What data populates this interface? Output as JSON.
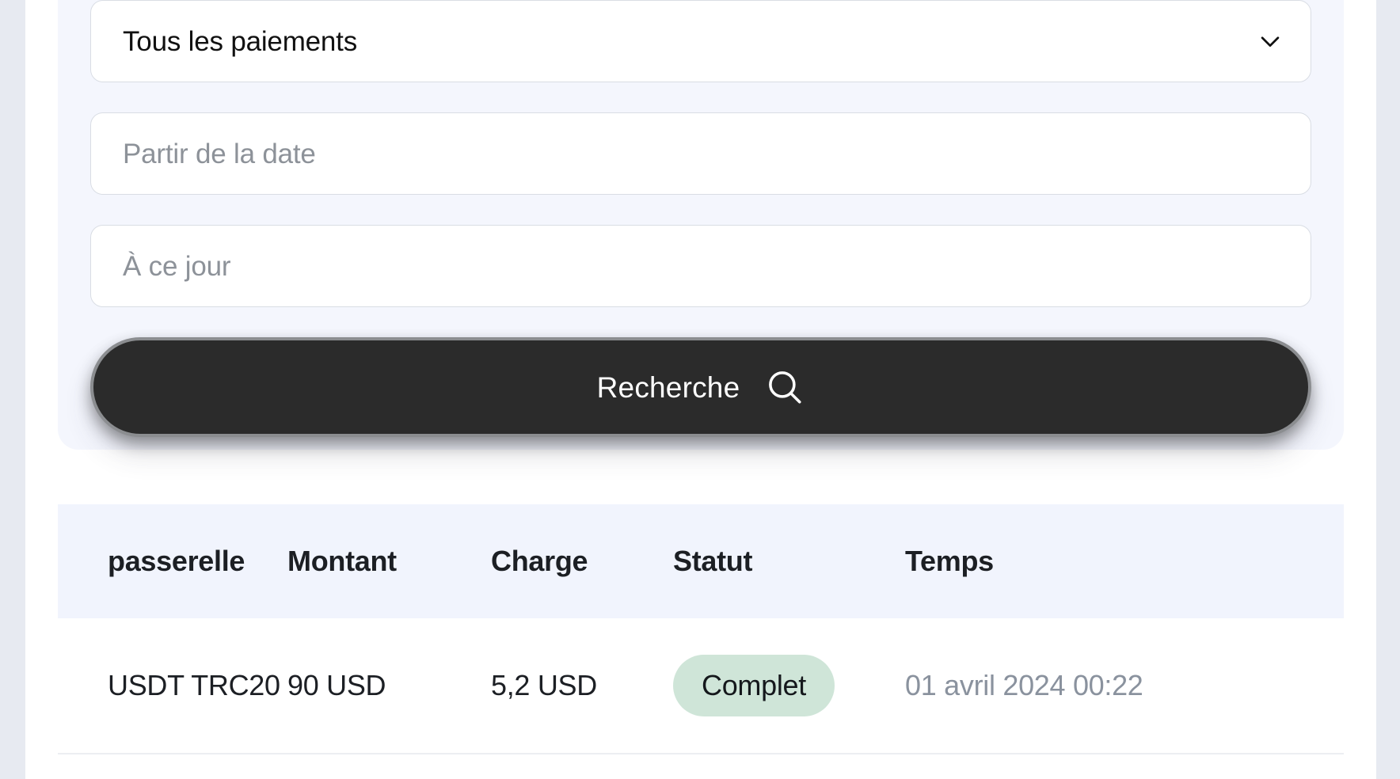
{
  "filters": {
    "payment_type_select": {
      "value": "Tous les paiements",
      "icon": "chevron-down-icon"
    },
    "date_from": {
      "value": "",
      "placeholder": "Partir de la date"
    },
    "date_to": {
      "value": "",
      "placeholder": "À ce jour"
    },
    "search_button": {
      "label": "Recherche",
      "icon": "search-icon"
    }
  },
  "table": {
    "columns": [
      {
        "key": "gateway",
        "label": "passerelle"
      },
      {
        "key": "amount",
        "label": "Montant"
      },
      {
        "key": "charge",
        "label": "Charge"
      },
      {
        "key": "status",
        "label": "Statut"
      },
      {
        "key": "time",
        "label": "Temps"
      }
    ],
    "rows": [
      {
        "gateway": "USDT TRC20",
        "amount": "90 USD",
        "charge": "5,2 USD",
        "status": "Complet",
        "time": "01 avril 2024 00:22"
      }
    ]
  },
  "colors": {
    "card_background": "#f4f6fd",
    "table_header_background": "#f1f4fd",
    "button_background": "#2b2b2b",
    "button_text": "#ffffff",
    "status_badge_background": "#cfe5d8",
    "status_badge_text": "#15181c",
    "time_text": "#8a929e",
    "placeholder_text": "#8d9299",
    "page_gutter": "#e7eaf1"
  }
}
